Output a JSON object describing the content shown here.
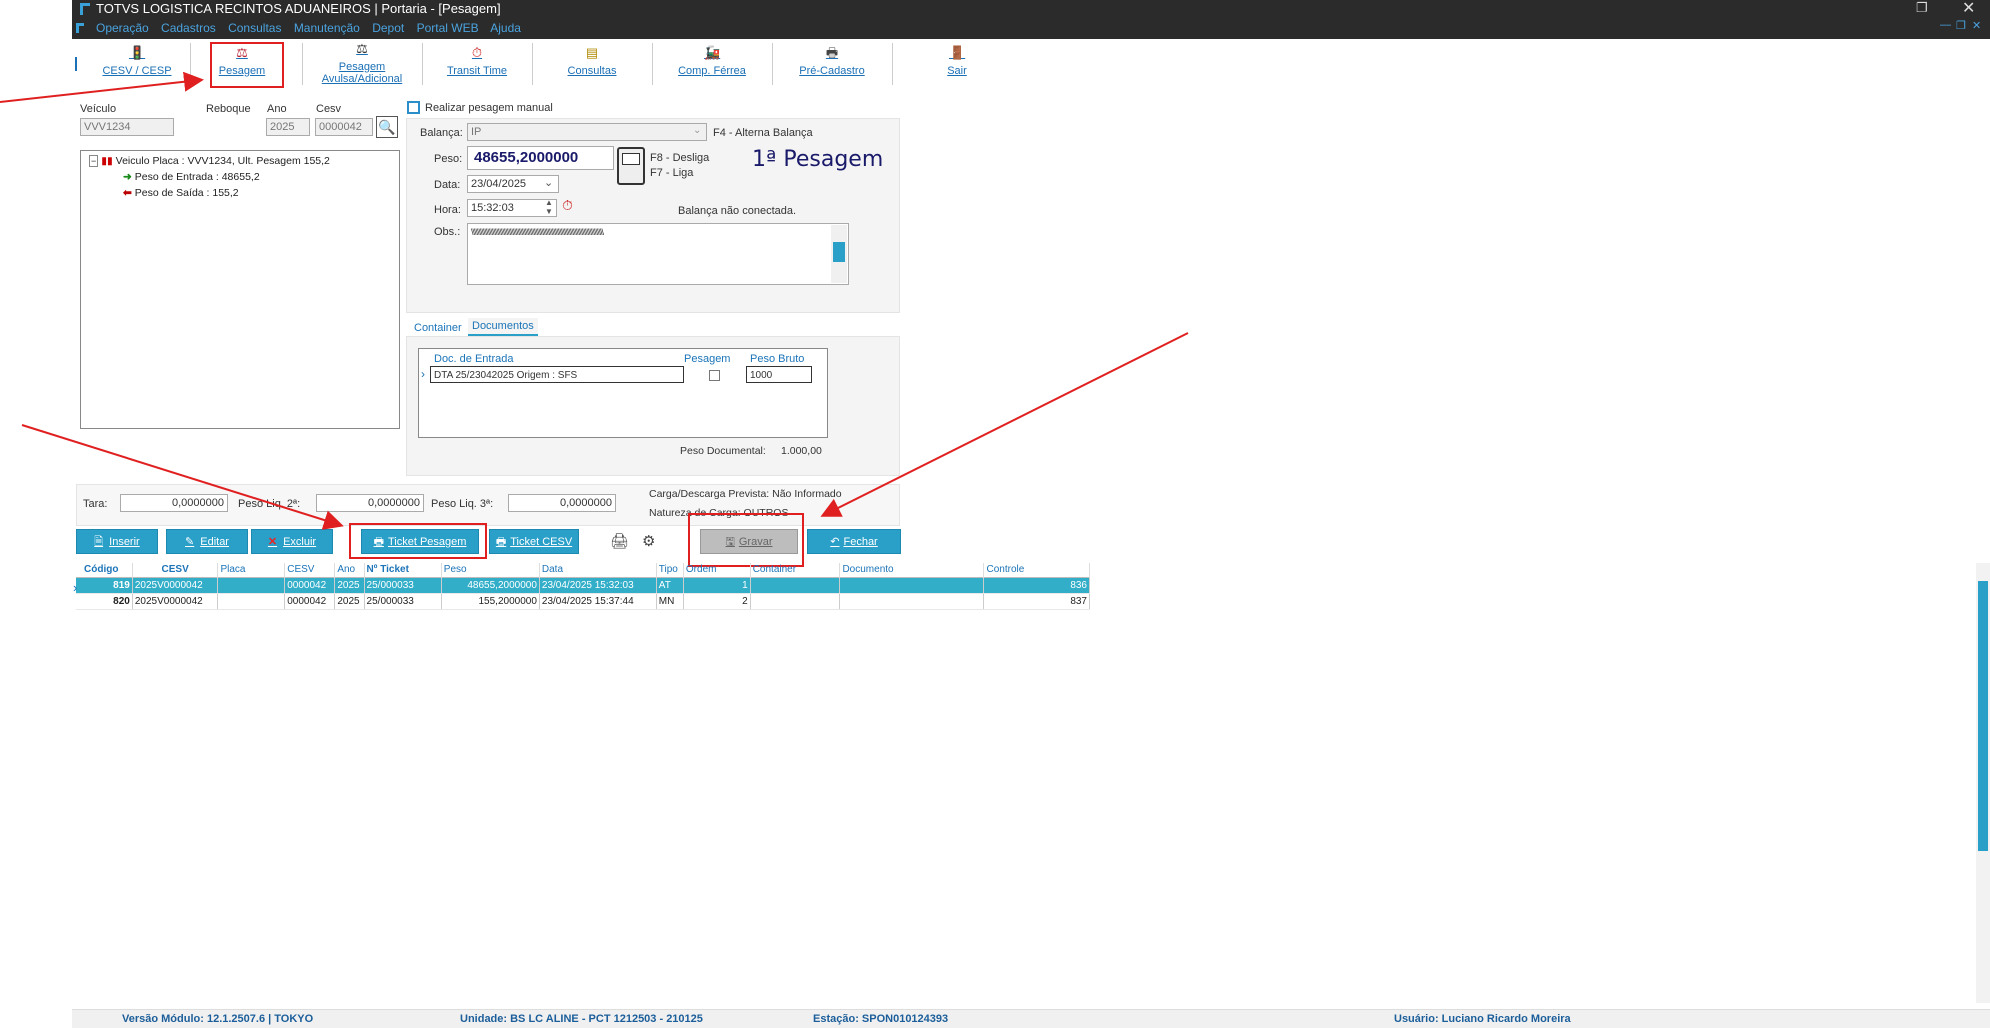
{
  "app": {
    "title": "TOTVS LOGISTICA RECINTOS ADUANEIROS | Portaria - [Pesagem]",
    "menu": [
      "Operação",
      "Cadastros",
      "Consultas",
      "Manutenção",
      "Depot",
      "Portal WEB",
      "Ajuda"
    ]
  },
  "toolbar": {
    "cesv": "CESV / CESP",
    "pesagem": "Pesagem",
    "pesagem_avulsa_1": "Pesagem",
    "pesagem_avulsa_2": "Avulsa/Adicional",
    "transit": "Transit Time",
    "consultas": "Consultas",
    "comp_ferrea": "Comp. Férrea",
    "pre_cadastro": "Pré-Cadastro",
    "sair": "Sair"
  },
  "form": {
    "veiculo_label": "Veículo",
    "veiculo": "VVV1234",
    "reboque_label": "Reboque",
    "ano_label": "Ano",
    "ano": "2025",
    "cesv_label": "Cesv",
    "cesv": "0000042",
    "manual_label": "Realizar pesagem manual",
    "balanca_label": "Balança:",
    "balanca": "IP",
    "alterna": "F4 - Alterna Balança",
    "peso_label": "Peso:",
    "peso": "48655,2000000",
    "desliga": "F8 - Desliga",
    "liga": "F7 - Liga",
    "pesagem_num": "1ª Pesagem",
    "data_label": "Data:",
    "data": "23/04/2025",
    "hora_label": "Hora:",
    "hora": "15:32:03",
    "conexao": "Balança não conectada.",
    "obs_label": "Obs.:",
    "obs": "\\\\\\\\\\\\\\\\\\\\\\\\\\\\\\\\\\\\\\\\\\\\\\\\\\\\\\\\\\\\\\\\\\\\\\\\\\\\\\\\\\\\\\\\\\\\\\\\\\\\\\\\\\\\\\\\\\\\\\\\\\\\\\\\\\\\\\\\\\\\\\\\\\\\\\\\\\\\\\\\\\\\\\\\\\\\\\\\"
  },
  "tree": {
    "root": "Veiculo Placa : VVV1234, Ult. Pesagem 155,2",
    "entrada": "Peso de Entrada : 48655,2",
    "saida": "Peso de Saída : 155,2"
  },
  "tabs": {
    "container": "Container",
    "documentos": "Documentos"
  },
  "docs": {
    "col_doc": "Doc. de Entrada",
    "col_pesagem": "Pesagem",
    "col_peso": "Peso Bruto",
    "row_doc": "DTA 25/23042025   Origem : SFS",
    "row_peso": "1000",
    "peso_doc_label": "Peso Documental:",
    "peso_doc": "1.000,00"
  },
  "summary": {
    "tara_label": "Tara:",
    "tara": "0,0000000",
    "liq2_label": "Peso Liq. 2ª:",
    "liq2": "0,0000000",
    "liq3_label": "Peso Liq. 3ª:",
    "liq3": "0,0000000",
    "carga": "Carga/Descarga Prevista: Não Informado",
    "natureza": "Natureza de Carga: OUTROS"
  },
  "buttons": {
    "inserir": "Inserir",
    "editar": "Editar",
    "excluir": "Excluir",
    "ticket_pesagem": "Ticket Pesagem",
    "ticket_cesv": "Ticket CESV",
    "gravar": "Gravar",
    "fechar": "Fechar"
  },
  "grid": {
    "columns": [
      "Código",
      "CESV",
      "Placa",
      "CESV",
      "Ano",
      "Nº Ticket",
      "Peso",
      "Data",
      "Tipo",
      "Ordem",
      "Container",
      "Documento",
      "Controle"
    ],
    "rows": [
      [
        "819",
        "2025V0000042",
        "",
        "0000042",
        "2025",
        "25/000033",
        "48655,2000000",
        "23/04/2025 15:32:03",
        "AT",
        "1",
        "",
        "",
        "836"
      ],
      [
        "820",
        "2025V0000042",
        "",
        "0000042",
        "2025",
        "25/000033",
        "155,2000000",
        "23/04/2025 15:37:44",
        "MN",
        "2",
        "",
        "",
        "837"
      ]
    ]
  },
  "status": {
    "versao": "Versão Módulo:  12.1.2507.6  |  TOKYO",
    "unidade": "Unidade: BS LC ALINE - PCT 1212503 - 210125",
    "estacao": "Estação: SPON010124393",
    "usuario": "Usuário: Luciano Ricardo Moreira"
  }
}
